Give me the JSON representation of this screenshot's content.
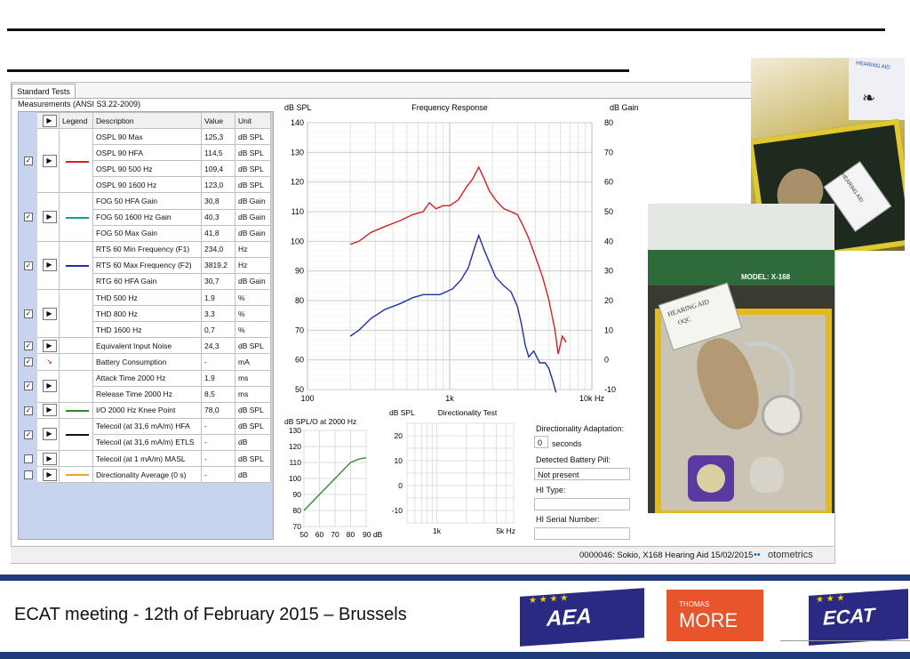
{
  "app": {
    "tab_label": "Standard Tests",
    "measurements_title": "Measurements (ANSI S3.22-2009)",
    "columns": {
      "legend": "Legend",
      "description": "Description",
      "value": "Value",
      "unit": "Unit"
    }
  },
  "measurements": [
    {
      "group": 1,
      "desc": "OSPL 90 Max",
      "value": "125,3",
      "unit": "dB SPL"
    },
    {
      "group": 1,
      "desc": "OSPL 90 HFA",
      "value": "114,5",
      "unit": "dB SPL"
    },
    {
      "group": 1,
      "desc": "OSPL 90 500 Hz",
      "value": "109,4",
      "unit": "dB SPL"
    },
    {
      "group": 1,
      "desc": "OSPL 90 1600 Hz",
      "value": "123,0",
      "unit": "dB SPL"
    },
    {
      "group": 2,
      "desc": "FOG 50 HFA Gain",
      "value": "30,8",
      "unit": "dB Gain"
    },
    {
      "group": 2,
      "desc": "FOG 50 1600 Hz Gain",
      "value": "40,3",
      "unit": "dB Gain"
    },
    {
      "group": 2,
      "desc": "FOG 50 Max Gain",
      "value": "41,8",
      "unit": "dB Gain"
    },
    {
      "group": 3,
      "desc": "RTS 60 Min Frequency (F1)",
      "value": "234,0",
      "unit": "Hz"
    },
    {
      "group": 3,
      "desc": "RTS 60 Max Frequency (F2)",
      "value": "3819,2",
      "unit": "Hz"
    },
    {
      "group": 3,
      "desc": "RTG 60 HFA Gain",
      "value": "30,7",
      "unit": "dB Gain"
    },
    {
      "group": 4,
      "desc": "THD 500 Hz",
      "value": "1,9",
      "unit": "%"
    },
    {
      "group": 4,
      "desc": "THD 800 Hz",
      "value": "3,3",
      "unit": "%"
    },
    {
      "group": 4,
      "desc": "THD 1600 Hz",
      "value": "0,7",
      "unit": "%"
    },
    {
      "group": 5,
      "desc": "Equivalent Input Noise",
      "value": "24,3",
      "unit": "dB SPL"
    },
    {
      "group": 6,
      "desc": "Battery Consumption",
      "value": "-",
      "unit": "mA"
    },
    {
      "group": 7,
      "desc": "Attack Time 2000 Hz",
      "value": "1,9",
      "unit": "ms"
    },
    {
      "group": 7,
      "desc": "Release Time 2000 Hz",
      "value": "8,5",
      "unit": "ms"
    },
    {
      "group": 8,
      "desc": "I/O 2000 Hz Knee Point",
      "value": "78,0",
      "unit": "dB SPL"
    },
    {
      "group": 9,
      "desc": "Telecoil (at 31,6 mA/m) HFA",
      "value": "-",
      "unit": "dB SPL"
    },
    {
      "group": 9,
      "desc": "Telecoil (at 31,6 mA/m) ETLS",
      "value": "-",
      "unit": "dB"
    },
    {
      "group": 10,
      "desc": "Telecoil (at 1 mA/m) MASL",
      "value": "-",
      "unit": "dB SPL"
    },
    {
      "group": 11,
      "desc": "Directionality Average (0 s)",
      "value": "-",
      "unit": "dB"
    }
  ],
  "groups": [
    {
      "checked": true,
      "legend_color": "#d42020"
    },
    {
      "checked": true,
      "legend_color": "#1a9a9a"
    },
    {
      "checked": true,
      "legend_color": "#1f2fa8"
    },
    {
      "checked": true,
      "legend_color": ""
    },
    {
      "checked": true,
      "legend_color": ""
    },
    {
      "checked": true,
      "legend_color": ""
    },
    {
      "checked": true,
      "legend_color": ""
    },
    {
      "checked": true,
      "legend_color": "#2a8a2a"
    },
    {
      "checked": true,
      "legend_color": "#111111"
    },
    {
      "checked": false,
      "legend_color": ""
    },
    {
      "checked": false,
      "legend_color": "#f0a030"
    }
  ],
  "chart_data": [
    {
      "type": "line",
      "title": "Frequency Response",
      "ylabel_left": "dB SPL",
      "ylabel_right": "dB Gain",
      "xscale": "log",
      "xlim": [
        100,
        10000
      ],
      "ylim_left": [
        50,
        140
      ],
      "ylim_right": [
        -10,
        80
      ],
      "xticks": [
        "100",
        "1k",
        "10k Hz"
      ],
      "yticks_left": [
        "140",
        "130",
        "120",
        "110",
        "100",
        "90",
        "80",
        "70",
        "60",
        "50"
      ],
      "yticks_right": [
        "80",
        "70",
        "60",
        "50",
        "40",
        "30",
        "20",
        "10",
        "0",
        "-10"
      ],
      "series": [
        {
          "color": "#d42020",
          "x": [
            200,
            230,
            280,
            350,
            450,
            550,
            650,
            720,
            800,
            900,
            1000,
            1150,
            1300,
            1450,
            1600,
            1750,
            1900,
            2100,
            2400,
            2700,
            3000,
            3300,
            3600,
            4000,
            4500,
            5000,
            5500,
            5800,
            6200,
            6600
          ],
          "y": [
            99,
            100,
            103,
            105,
            107,
            109,
            110,
            113,
            111,
            112,
            112,
            114,
            118,
            121,
            125,
            121,
            117,
            114,
            111,
            110,
            109,
            105,
            101,
            95,
            88,
            80,
            70,
            62,
            68,
            66
          ]
        },
        {
          "color": "#1f2fa8",
          "x": [
            200,
            230,
            280,
            350,
            450,
            550,
            650,
            750,
            850,
            950,
            1050,
            1200,
            1350,
            1500,
            1600,
            1750,
            1900,
            2100,
            2400,
            2700,
            3000,
            3200,
            3400,
            3600,
            3900,
            4300,
            4700,
            5000,
            5300,
            5600
          ],
          "y": [
            68,
            70,
            74,
            77,
            79,
            81,
            82,
            82,
            82,
            83,
            84,
            87,
            91,
            98,
            102,
            97,
            93,
            88,
            85,
            83,
            78,
            72,
            65,
            61,
            63,
            59,
            59,
            57,
            53,
            49
          ]
        }
      ]
    },
    {
      "type": "line",
      "title": "dB SPL/O at 2000 Hz",
      "xlim": [
        50,
        90
      ],
      "ylim": [
        70,
        130
      ],
      "xticks": [
        "50",
        "60",
        "70",
        "80",
        "90 dB"
      ],
      "yticks": [
        "130",
        "120",
        "110",
        "100",
        "90",
        "80",
        "70"
      ],
      "series": [
        {
          "color": "#2a8a2a",
          "x": [
            50,
            55,
            60,
            65,
            70,
            75,
            80,
            85,
            90
          ],
          "y": [
            80,
            85,
            90,
            95,
            100,
            105,
            110,
            112,
            113
          ]
        }
      ]
    },
    {
      "type": "line",
      "title": "Directionality Test",
      "ylabel": "dB SPL",
      "xscale": "log",
      "xlim": [
        500,
        6000
      ],
      "ylim": [
        -15,
        25
      ],
      "xticks": [
        "1k",
        "5k Hz"
      ],
      "yticks": [
        "20",
        "10",
        "0",
        "-10"
      ],
      "series": []
    }
  ],
  "form": {
    "directionality_adaptation_label": "Directionality Adaptation:",
    "directionality_adaptation_value": "0",
    "seconds_label": "seconds",
    "detected_battery_pill_label": "Detected Battery Pill:",
    "detected_battery_pill_value": "Not present",
    "hi_type_label": "HI Type:",
    "hi_type_value": "",
    "hi_serial_label": "HI Serial Number:",
    "hi_serial_value": ""
  },
  "status_bar": {
    "text": "0000046: Sokio, X168 Hearing Aid  15/02/2015",
    "brand": "otometrics"
  },
  "photos": {
    "box_brand": "HEARING AID",
    "model_label": "MODEL: X-168",
    "card_text": "HEARING AID",
    "card_code": "OQC"
  },
  "footer": {
    "caption": "ECAT meeting - 12th of February 2015 – Brussels",
    "logo_aea": "AEA",
    "logo_tm_small": "THOMAS",
    "logo_tm_big": "MORE",
    "logo_ecat": "ECAT"
  }
}
